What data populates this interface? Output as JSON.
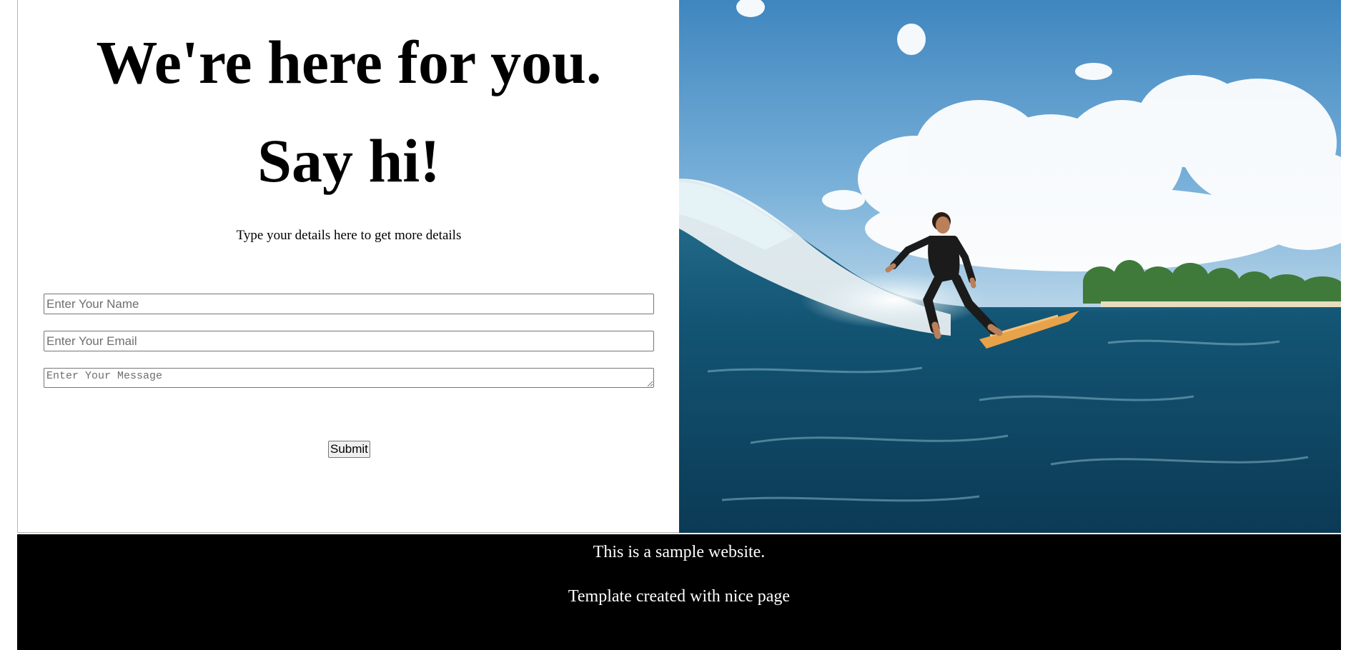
{
  "contact": {
    "heading_line1": "We're here for you.",
    "heading_line2": "Say hi!",
    "subtitle": "Type your details here to get more details",
    "name_placeholder": "Enter Your Name",
    "email_placeholder": "Enter Your Email",
    "message_placeholder": "Enter Your Message",
    "submit_label": "Submit"
  },
  "hero_image": {
    "subject": "surfer-riding-wave"
  },
  "footer": {
    "line1": "This is a sample website.",
    "line2": "Template created with nice page"
  },
  "colors": {
    "footer_background": "#000000",
    "footer_text": "#ffffff",
    "page_background": "#ffffff"
  }
}
